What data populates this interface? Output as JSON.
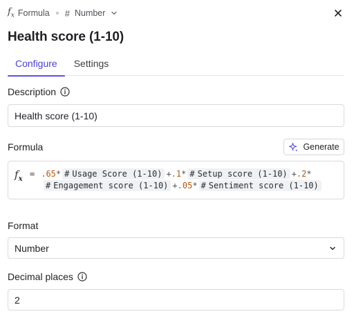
{
  "breadcrumb": {
    "formula_label": "Formula",
    "type_label": "Number"
  },
  "title": "Health score (1-10)",
  "tabs": [
    {
      "label": "Configure",
      "active": true
    },
    {
      "label": "Settings",
      "active": false
    }
  ],
  "description": {
    "label": "Description",
    "value": "Health score (1-10)"
  },
  "formula": {
    "label": "Formula",
    "generate_label": "Generate",
    "fx_symbol": "f",
    "fx_sub": "x",
    "equals": "=",
    "terms": [
      {
        "coef": ".65",
        "field": "Usage Score (1-10)"
      },
      {
        "coef": ".1",
        "field": "Setup score (1-10)"
      },
      {
        "coef": ".2",
        "field": "Engagement score (1-10)"
      },
      {
        "coef": ".05",
        "field": "Sentiment score (1-10)"
      }
    ],
    "multiply": "*",
    "plus": "+"
  },
  "format": {
    "label": "Format",
    "value": "Number"
  },
  "decimal_places": {
    "label": "Decimal places",
    "value": "2"
  },
  "colors": {
    "accent": "#5b4fe6",
    "number_literal": "#b8560f",
    "chip_bg": "#f0f1f4",
    "border": "#d9dadf"
  },
  "icons": [
    "fx-icon",
    "hash-icon",
    "chevron-down-icon",
    "close-icon",
    "info-icon",
    "sparkle-icon"
  ]
}
